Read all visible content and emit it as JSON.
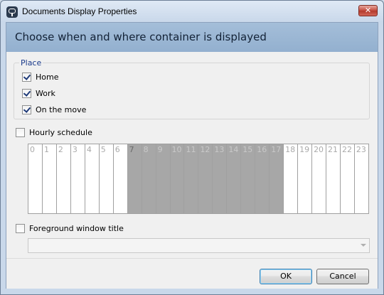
{
  "window": {
    "title": "Documents Display Properties",
    "close_glyph": "✕"
  },
  "header": {
    "title": "Choose when and where container is displayed"
  },
  "place": {
    "caption": "Place",
    "options": [
      {
        "label": "Home",
        "checked": true
      },
      {
        "label": "Work",
        "checked": true
      },
      {
        "label": "On the move",
        "checked": true
      }
    ]
  },
  "hourly": {
    "label": "Hourly schedule",
    "checked": false,
    "hours": [
      "0",
      "1",
      "2",
      "3",
      "4",
      "5",
      "6",
      "7",
      "8",
      "9",
      "10",
      "11",
      "12",
      "13",
      "14",
      "15",
      "16",
      "17",
      "18",
      "19",
      "20",
      "21",
      "22",
      "23"
    ],
    "selected_hours": [
      7,
      8,
      9,
      10,
      11,
      12,
      13,
      14,
      15,
      16,
      17
    ]
  },
  "foreground": {
    "label": "Foreground window title",
    "checked": false,
    "combo_value": ""
  },
  "buttons": {
    "ok": "OK",
    "cancel": "Cancel"
  },
  "icons": {
    "app": "chat-bubble-icon",
    "close": "close-icon",
    "combo": "chevron-down-icon"
  }
}
